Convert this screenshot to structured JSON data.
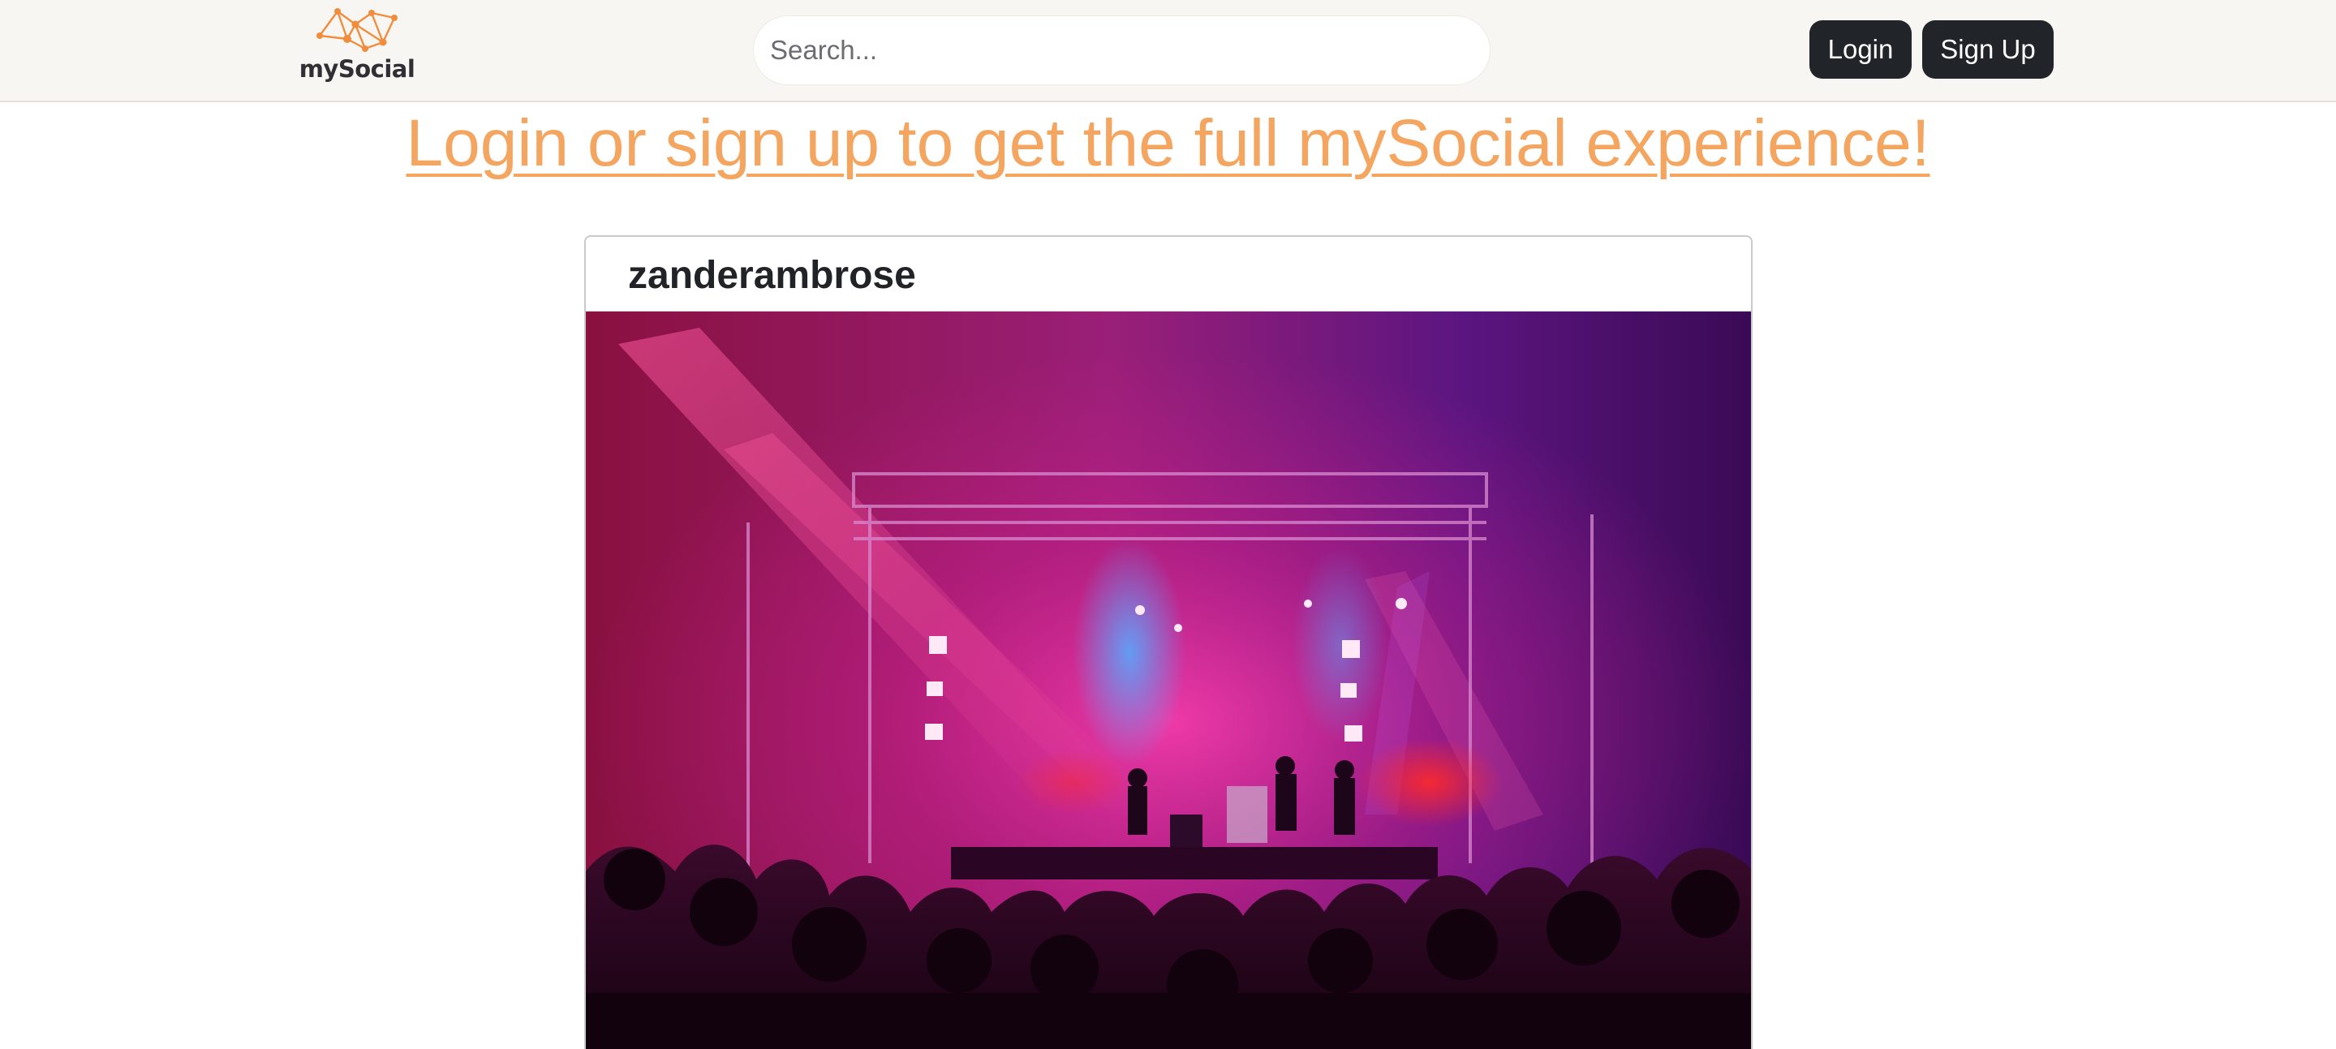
{
  "navbar": {
    "brand_name": "mySocial",
    "logo_icon": "network-nodes-icon",
    "search": {
      "placeholder": "Search...",
      "value": ""
    },
    "login_label": "Login",
    "signup_label": "Sign Up"
  },
  "cta_text": "Login or sign up to get the full mySocial experience!",
  "post": {
    "username": "zanderambrose",
    "image_icon": "concert-stage-photo"
  },
  "colors": {
    "navbar_bg": "#f8f6f2",
    "accent_orange": "#f4a560",
    "button_dark": "#212529",
    "text_dark": "#222326"
  }
}
